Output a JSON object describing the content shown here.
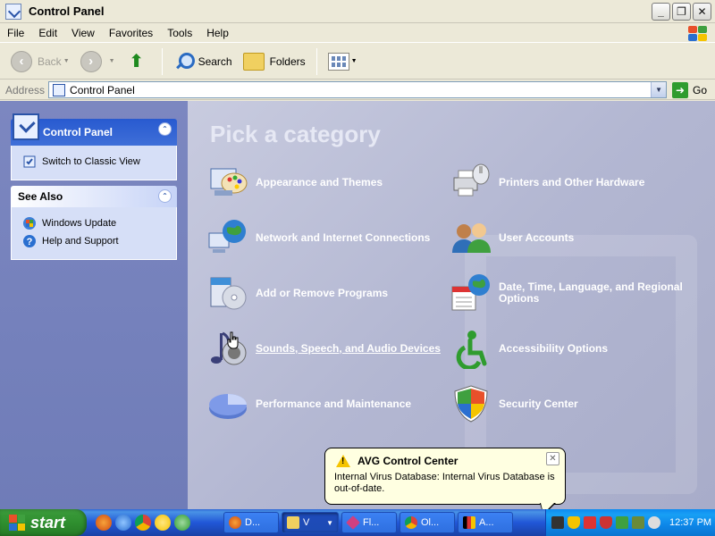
{
  "window": {
    "title": "Control Panel"
  },
  "menu": [
    "File",
    "Edit",
    "View",
    "Favorites",
    "Tools",
    "Help"
  ],
  "toolbar": {
    "back": "Back",
    "search": "Search",
    "folders": "Folders"
  },
  "address": {
    "label": "Address",
    "value": "Control Panel",
    "go": "Go"
  },
  "left_pane": {
    "control_panel": {
      "title": "Control Panel",
      "link": "Switch to Classic View"
    },
    "see_also": {
      "title": "See Also",
      "links": [
        "Windows Update",
        "Help and Support"
      ]
    }
  },
  "main": {
    "heading": "Pick a category",
    "categories": [
      "Appearance and Themes",
      "Printers and Other Hardware",
      "Network and Internet Connections",
      "User Accounts",
      "Add or Remove Programs",
      "Date, Time, Language, and Regional Options",
      "Sounds, Speech, and Audio Devices",
      "Accessibility Options",
      "Performance and Maintenance",
      "Security Center"
    ]
  },
  "balloon": {
    "title": "AVG Control Center",
    "message": "Internal Virus Database: Internal Virus Database is out-of-date."
  },
  "taskbar": {
    "start": "start",
    "tasks": [
      "D...",
      "V",
      "Fl...",
      "Ol...",
      "A..."
    ],
    "clock": "12:37 PM"
  },
  "colors": {
    "link_blue": "#215dc6",
    "category_text": "#ffffff",
    "taskbar_blue": "#2157d7",
    "start_green": "#2f8f2f"
  },
  "icons": [
    "back-icon",
    "forward-icon",
    "up-folder-icon",
    "search-icon",
    "folders-icon",
    "views-icon",
    "go-icon",
    "warning-icon"
  ]
}
